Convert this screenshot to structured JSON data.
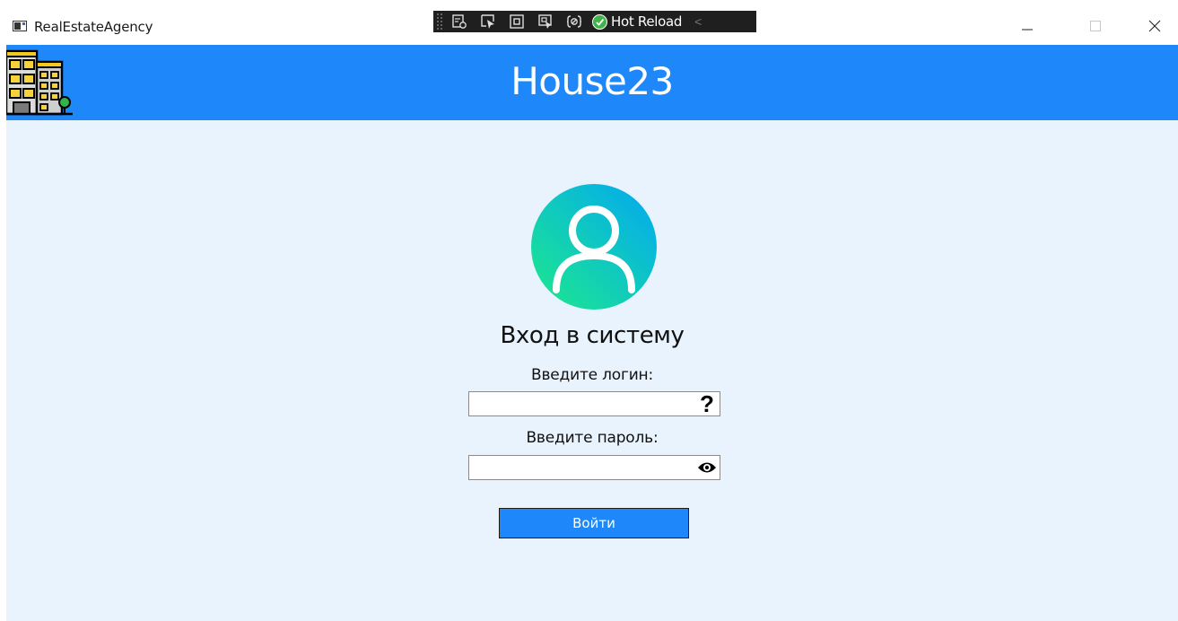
{
  "window": {
    "title": "RealEstateAgency",
    "icon": "app-window-icon",
    "controls": {
      "minimize_icon": "minimize-icon",
      "maximize_icon": "maximize-icon",
      "close_icon": "close-icon"
    }
  },
  "debug_toolbar": {
    "buttons": [
      "live-visual-tree-icon",
      "select-element-icon",
      "display-layout-adorners-icon",
      "track-focused-element-icon",
      "binding-failures-icon"
    ],
    "hot_reload_label": "Hot Reload",
    "hot_reload_status": "check-circle-icon",
    "collapse_glyph": "<"
  },
  "header": {
    "logo_icon": "building-logo-icon",
    "brand": "House23",
    "background": "#1e88fa"
  },
  "login": {
    "avatar_icon": "user-avatar-icon",
    "title": "Вход в систему",
    "login_label": "Введите логин:",
    "login_value": "",
    "login_help_glyph": "?",
    "password_label": "Введите пароль:",
    "password_value": "",
    "password_toggle_icon": "eye-icon",
    "submit_label": "Войти"
  },
  "colors": {
    "accent": "#1e88fa",
    "page_background": "#e8f3fe",
    "avatar_gradient_start": "#1de98b",
    "avatar_gradient_end": "#02a8f3"
  }
}
